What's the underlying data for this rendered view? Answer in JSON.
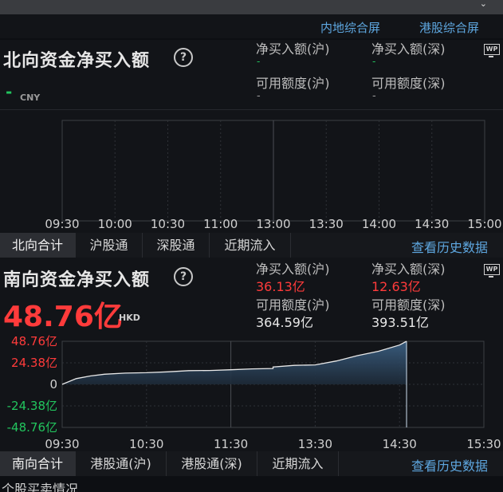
{
  "top_links": {
    "mainland": "内地综合屏",
    "hk": "港股综合屏"
  },
  "north": {
    "title": "北向资金净买入额",
    "help": "?",
    "main_value": "-",
    "currency": "CNY",
    "net_buy_sh_label": "净买入额(沪)",
    "net_buy_sh_value": "-",
    "net_buy_sz_label": "净买入额(深)",
    "net_buy_sz_value": "-",
    "quota_sh_label": "可用额度(沪)",
    "quota_sh_value": "-",
    "quota_sz_label": "可用额度(深)",
    "quota_sz_value": "-",
    "wp_icon": "WP",
    "time_ticks": [
      "09:30",
      "10:00",
      "10:30",
      "11:00",
      "13:00",
      "13:30",
      "14:00",
      "14:30",
      "15:00"
    ]
  },
  "north_tabs": {
    "total": "北向合计",
    "sh": "沪股通",
    "sz": "深股通",
    "recent": "近期流入",
    "history": "查看历史数据"
  },
  "south": {
    "title": "南向资金净买入额",
    "help": "?",
    "main_value": "48.76亿",
    "currency": "HKD",
    "net_buy_sh_label": "净买入额(沪)",
    "net_buy_sh_value": "36.13亿",
    "net_buy_sz_label": "净买入额(深)",
    "net_buy_sz_value": "12.63亿",
    "quota_sh_label": "可用额度(沪)",
    "quota_sh_value": "364.59亿",
    "quota_sz_label": "可用额度(深)",
    "quota_sz_value": "393.51亿",
    "wp_icon": "WP",
    "y_ticks": [
      "48.76亿",
      "24.38亿",
      "0",
      "-24.38亿",
      "-48.76亿"
    ],
    "time_ticks": [
      "09:30",
      "10:30",
      "11:30",
      "13:30",
      "14:30",
      "15:30"
    ]
  },
  "south_tabs": {
    "total": "南向合计",
    "sh": "港股通(沪)",
    "sz": "港股通(深)",
    "recent": "近期流入",
    "history": "查看历史数据"
  },
  "footer_text": "个股买卖情况",
  "colors": {
    "up": "#ff3b3b",
    "down": "#22c55e",
    "link": "#5ea7e0",
    "line": "#e8e8e8",
    "fill": "#2e4a66"
  },
  "chart_data": [
    {
      "type": "line",
      "title": "北向资金净买入额",
      "x_ticks": [
        "09:30",
        "10:00",
        "10:30",
        "11:00",
        "13:00",
        "13:30",
        "14:00",
        "14:30",
        "15:00"
      ],
      "series": []
    },
    {
      "type": "area",
      "title": "南向资金净买入额",
      "x_ticks": [
        "09:30",
        "10:30",
        "11:30",
        "13:30",
        "14:30",
        "15:30"
      ],
      "ylim": [
        -48.76,
        48.76
      ],
      "y_ticks": [
        "48.76亿",
        "24.38亿",
        "0",
        "-24.38亿",
        "-48.76亿"
      ],
      "series": [
        {
          "x": [
            "09:30",
            "09:40",
            "09:50",
            "10:00",
            "10:15",
            "10:30",
            "10:45",
            "11:00",
            "11:15",
            "11:30",
            "11:45",
            "12:00",
            "13:00",
            "13:15",
            "13:30",
            "13:45",
            "14:00",
            "14:15",
            "14:30",
            "14:35"
          ],
          "y": [
            0,
            6.5,
            9.5,
            11.5,
            12.7,
            13.2,
            14.2,
            15.5,
            15.7,
            16.5,
            17.5,
            18.0,
            19.7,
            21.5,
            22.0,
            26.5,
            32.5,
            37.5,
            44.5,
            48.76
          ]
        }
      ]
    }
  ]
}
